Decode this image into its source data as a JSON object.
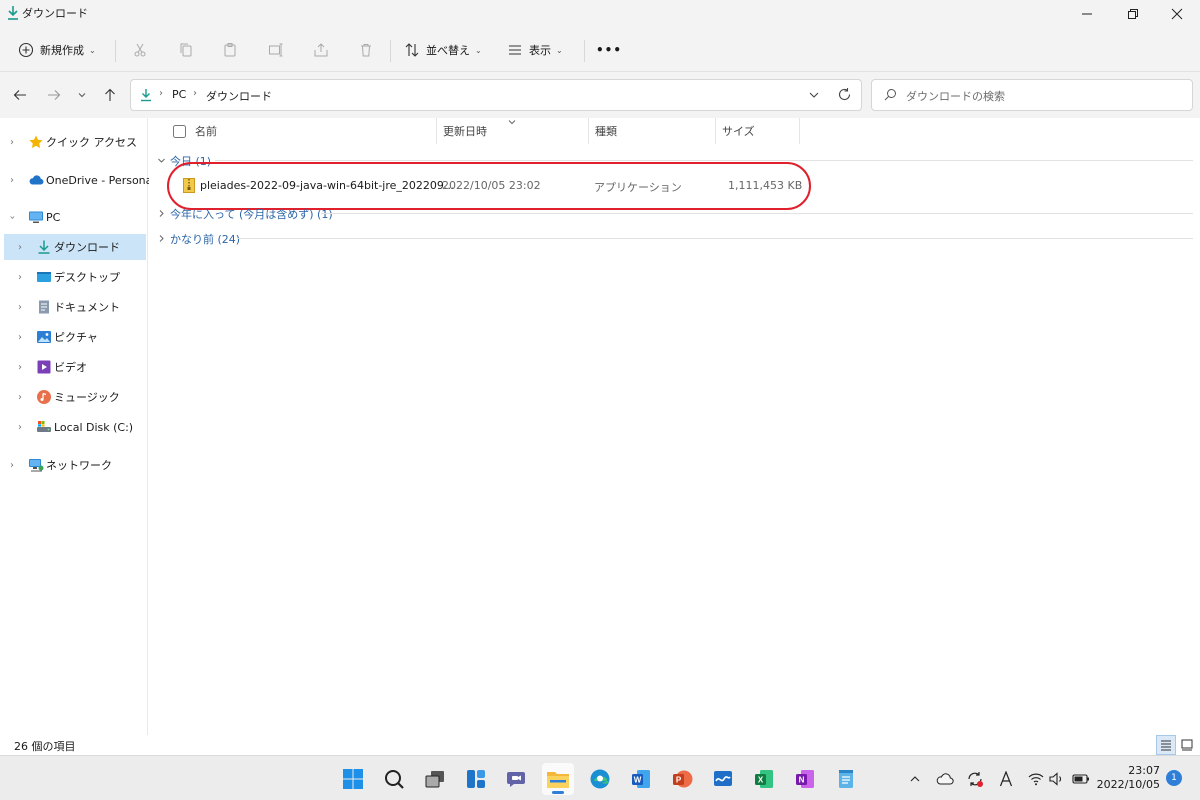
{
  "window": {
    "title": "ダウンロード"
  },
  "commands": {
    "new_label": "新規作成",
    "sort_label": "並べ替え",
    "view_label": "表示",
    "more_label": "•••"
  },
  "address": {
    "crumbs": [
      "PC",
      "ダウンロード"
    ],
    "search_placeholder": "ダウンロードの検索"
  },
  "sidebar": {
    "items": [
      {
        "label": "クイック アクセス",
        "icon": "star-icon"
      },
      {
        "label": "OneDrive - Personal",
        "icon": "cloud-icon"
      },
      {
        "label": "PC",
        "icon": "monitor-icon"
      },
      {
        "label": "ダウンロード",
        "icon": "download-icon"
      },
      {
        "label": "デスクトップ",
        "icon": "desktop-folder-icon"
      },
      {
        "label": "ドキュメント",
        "icon": "document-icon"
      },
      {
        "label": "ピクチャ",
        "icon": "picture-icon"
      },
      {
        "label": "ビデオ",
        "icon": "video-icon"
      },
      {
        "label": "ミュージック",
        "icon": "music-icon"
      },
      {
        "label": "Local Disk (C:)",
        "icon": "drive-icon"
      },
      {
        "label": "ネットワーク",
        "icon": "network-icon"
      }
    ]
  },
  "columns": [
    "名前",
    "更新日時",
    "種類",
    "サイズ"
  ],
  "groups": [
    {
      "label": "今日 (1)"
    },
    {
      "label": "今年に入って (今月は含めず) (1)"
    },
    {
      "label": "かなり前 (24)"
    }
  ],
  "files": [
    {
      "name": "pleiades-2022-09-java-win-64bit-jre_202209...",
      "modified": "2022/10/05 23:02",
      "type": "アプリケーション",
      "size": "1,111,453 KB"
    }
  ],
  "status": {
    "item_count": "26 個の項目"
  },
  "taskbar": {
    "time": "23:07",
    "date": "2022/10/05",
    "notifications": "1"
  },
  "colors": {
    "accent": "#2f7fd8",
    "highlight": "#e0202c",
    "selected": "#cce4f7",
    "group_text": "#2b65a8"
  }
}
